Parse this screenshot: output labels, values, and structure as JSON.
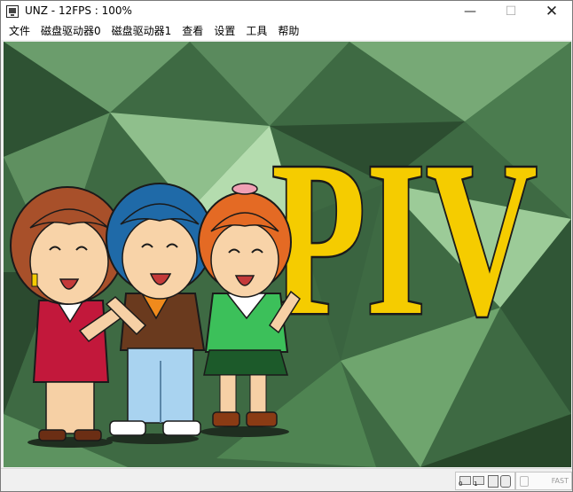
{
  "window": {
    "title": "UNZ - 12FPS : 100%"
  },
  "titlebar": {
    "minimize_glyph": "—",
    "maximize_glyph": "☐",
    "close_glyph": "✕"
  },
  "menubar": {
    "items": [
      "文件",
      "磁盘驱动器0",
      "磁盘驱动器1",
      "查看",
      "设置",
      "工具",
      "帮助"
    ]
  },
  "screen": {
    "logo_text": "PIV",
    "logo_color": "#f5cc00",
    "background_color": "#3e6a43"
  },
  "statusbar": {
    "drive0_label": "0",
    "drive1_label": "1",
    "speed_label": "FAST"
  },
  "icons": [
    "app-icon",
    "disk-drive-0-icon",
    "disk-drive-1-icon",
    "cassette-icon",
    "screenshot-icon",
    "power-lamp-icon"
  ]
}
